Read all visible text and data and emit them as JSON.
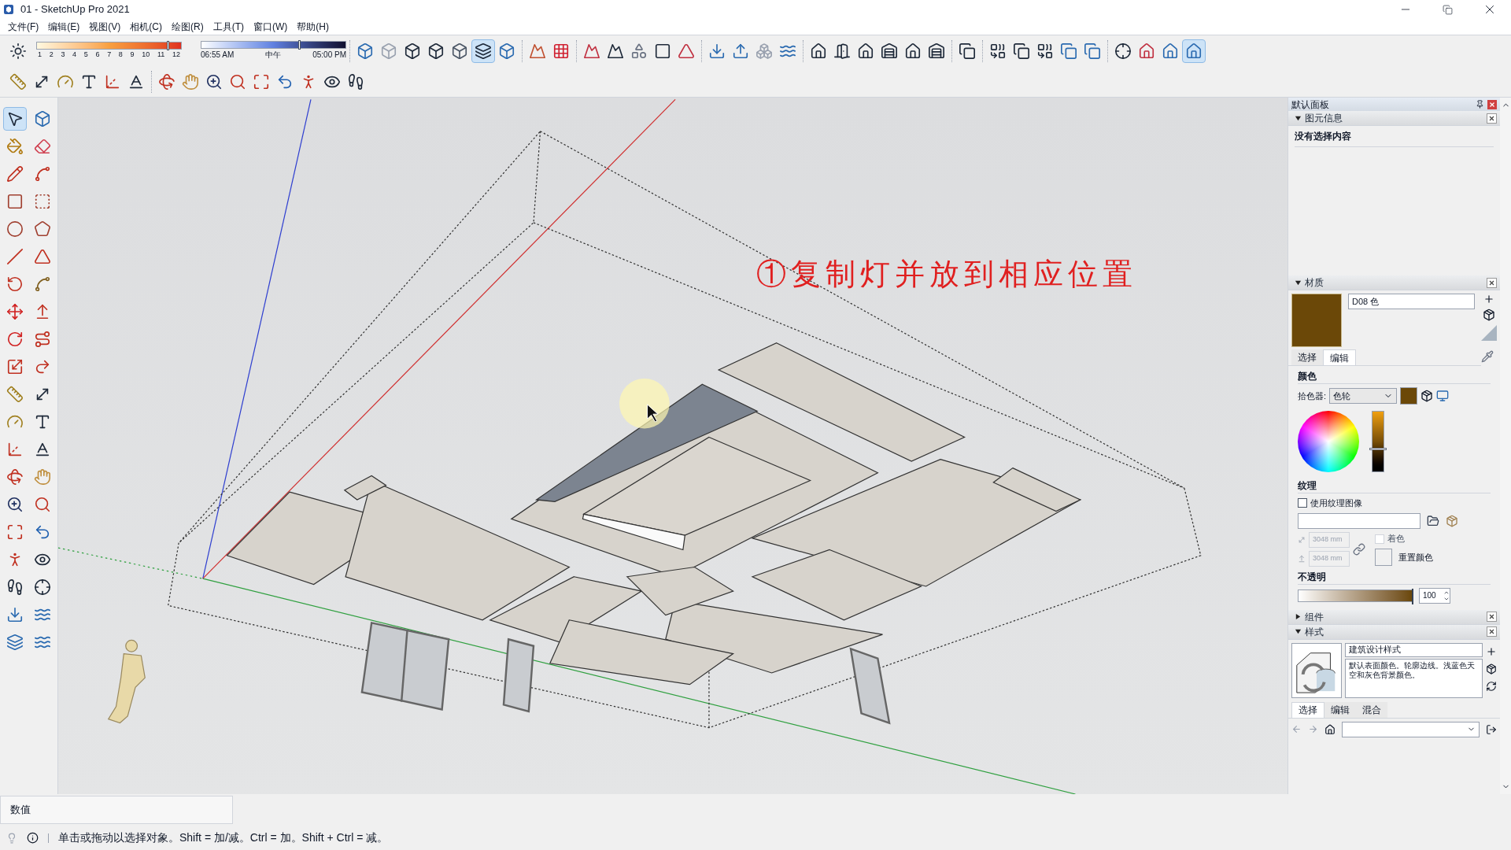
{
  "window": {
    "title": "01 - SketchUp Pro 2021"
  },
  "menu": [
    "文件(F)",
    "编辑(E)",
    "视图(V)",
    "相机(C)",
    "绘图(R)",
    "工具(T)",
    "窗口(W)",
    "帮助(H)"
  ],
  "shadow_date": {
    "months": [
      "1",
      "2",
      "3",
      "4",
      "5",
      "6",
      "7",
      "8",
      "9",
      "10",
      "11",
      "12"
    ],
    "level": 0.9
  },
  "shadow_time": {
    "start": "06:55 AM",
    "middle": "中午",
    "end": "05:00 PM",
    "level": 0.67
  },
  "style_buttons": [
    {
      "selected": false
    },
    {
      "selected": false
    },
    {
      "selected": false
    },
    {
      "selected": false
    },
    {
      "selected": false
    },
    {
      "selected": true
    },
    {
      "selected": false
    }
  ],
  "view_buttons": [
    {
      "selected": false
    },
    {
      "selected": false
    },
    {
      "selected": false
    },
    {
      "selected": true
    }
  ],
  "tools": [
    {
      "selected": true
    },
    {
      "selected": false
    },
    {
      "selected": false
    },
    {
      "selected": false
    },
    {
      "selected": false
    },
    {
      "selected": false
    },
    {
      "selected": false
    },
    {
      "selected": false
    },
    {
      "selected": false
    },
    {
      "selected": false
    },
    {
      "selected": false
    },
    {
      "selected": false
    },
    {
      "selected": false
    },
    {
      "selected": false
    },
    {
      "selected": false
    },
    {
      "selected": false
    },
    {
      "selected": false
    },
    {
      "selected": false
    },
    {
      "selected": false
    },
    {
      "selected": false
    },
    {
      "selected": false
    },
    {
      "selected": false
    },
    {
      "selected": false
    },
    {
      "selected": false
    },
    {
      "selected": false
    },
    {
      "selected": false
    },
    {
      "selected": false
    },
    {
      "selected": false
    },
    {
      "selected": false
    },
    {
      "selected": false
    },
    {
      "selected": false
    },
    {
      "selected": false
    },
    {
      "selected": false
    },
    {
      "selected": false
    },
    {
      "selected": false
    },
    {
      "selected": false
    },
    {
      "selected": false
    },
    {
      "selected": false
    },
    {
      "selected": false
    },
    {
      "selected": false
    }
  ],
  "annotation": "①复制灯并放到相应位置",
  "panel": {
    "title": "默认面板",
    "entity_info": {
      "title": "图元信息",
      "expanded": true,
      "text": "没有选择内容"
    },
    "materials": {
      "title": "材质",
      "expanded": true,
      "name": "D08 色",
      "tabs": [
        {
          "label": "选择",
          "selected": false
        },
        {
          "label": "编辑",
          "selected": true
        }
      ],
      "color_heading": "颜色",
      "picker_label": "拾色器:",
      "picker_value": "色轮",
      "texture_heading": "纹理",
      "use_texture": {
        "label": "使用纹理图像",
        "checked": false
      },
      "width": "3048 mm",
      "height": "3048 mm",
      "colorize": {
        "label": "着色",
        "checked": false
      },
      "reset_label": "重置颜色",
      "opacity_heading": "不透明",
      "opacity": {
        "level": 1,
        "value": "100"
      }
    },
    "components": {
      "title": "组件",
      "expanded": false
    },
    "styles": {
      "title": "样式",
      "expanded": true,
      "name": "建筑设计样式",
      "description": "默认表面颜色。轮廓边线。浅蓝色天空和灰色背景颜色。",
      "tabs": [
        {
          "label": "选择",
          "selected": true
        },
        {
          "label": "编辑",
          "selected": false
        },
        {
          "label": "混合",
          "selected": false
        }
      ]
    }
  },
  "measurements": {
    "label": "数值"
  },
  "status_bar": {
    "text": "单击或拖动以选择对象。Shift = 加/减。Ctrl = 加。Shift + Ctrl = 减。"
  }
}
